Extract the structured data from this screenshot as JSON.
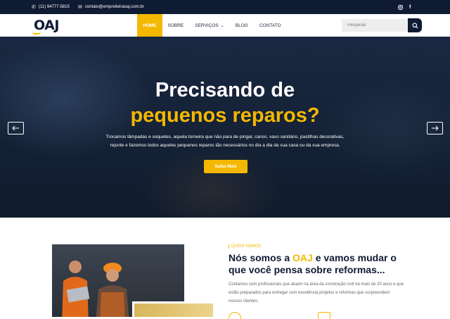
{
  "topbar": {
    "phone": "(11) 94777-5815",
    "email": "contato@empreiteiraoaj.com.br",
    "phone_icon": "phone-icon",
    "email_icon": "mail-icon",
    "social_icons": [
      "instagram-icon",
      "facebook-icon"
    ]
  },
  "nav": {
    "logo": "OAJ",
    "menu": [
      {
        "label": "HOME",
        "active": true
      },
      {
        "label": "SOBRE"
      },
      {
        "label": "SERVIÇOS",
        "has_dropdown": true
      },
      {
        "label": "BLOG"
      },
      {
        "label": "CONTATO"
      }
    ],
    "search_placeholder": "Pesquisar",
    "search_icon": "search-icon"
  },
  "hero": {
    "title_line1": "Precisando de",
    "title_line2": "pequenos reparos?",
    "description_line1": "Trocamos lâmpadas e soquetes, aquela torneira que não para de pingar, canos, vaso sanitário, pastilhas decorativas,",
    "description_line2": "rejunte e fazemos todos aqueles pequenos reparos tão necessários no dia a dia da sua casa ou da sua empresa.",
    "button_label": "Saiba Mais",
    "prev_icon": "arrow-left-icon",
    "next_icon": "arrow-right-icon"
  },
  "about": {
    "eyebrow": "QUEM SOMOS",
    "title_prefix": "Nós somos a ",
    "title_brand": "OAJ",
    "title_suffix": " e vamos mudar o que você pensa sobre reformas...",
    "text": "Contamos com profissionais que atuam na área da construção civil há mais de 20 anos e que estão preparados para entregar com excelência projetos e reformas que surpreendem nossos clientes."
  },
  "colors": {
    "accent": "#f5b800",
    "navy": "#0f1a33"
  }
}
